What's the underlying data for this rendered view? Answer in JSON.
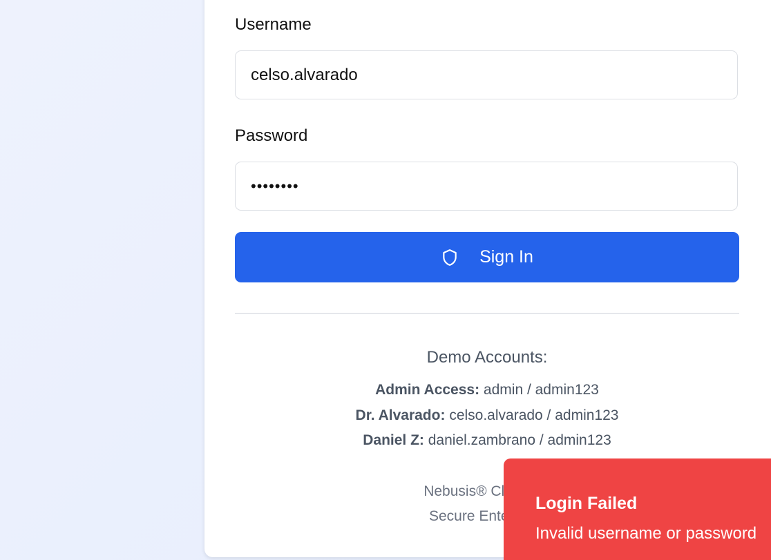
{
  "form": {
    "username_label": "Username",
    "username_value": "celso.alvarado",
    "password_label": "Password",
    "password_value": "••••••••",
    "submit_label": "Sign In",
    "submit_icon": "shield-icon"
  },
  "demo": {
    "title": "Demo Accounts:",
    "accounts": [
      {
        "name": "Admin Access:",
        "credentials": "admin / admin123"
      },
      {
        "name": "Dr. Alvarado:",
        "credentials": "celso.alvarado / admin123"
      },
      {
        "name": "Daniel Z:",
        "credentials": "daniel.zambrano / admin123"
      }
    ]
  },
  "footer": {
    "line1": "Nebusis® Cloud Se",
    "line2": "Secure Enterprise"
  },
  "toast": {
    "title": "Login Failed",
    "message": "Invalid username or password",
    "color": "#ef4444"
  },
  "colors": {
    "accent": "#2563eb",
    "error": "#ef4444"
  }
}
